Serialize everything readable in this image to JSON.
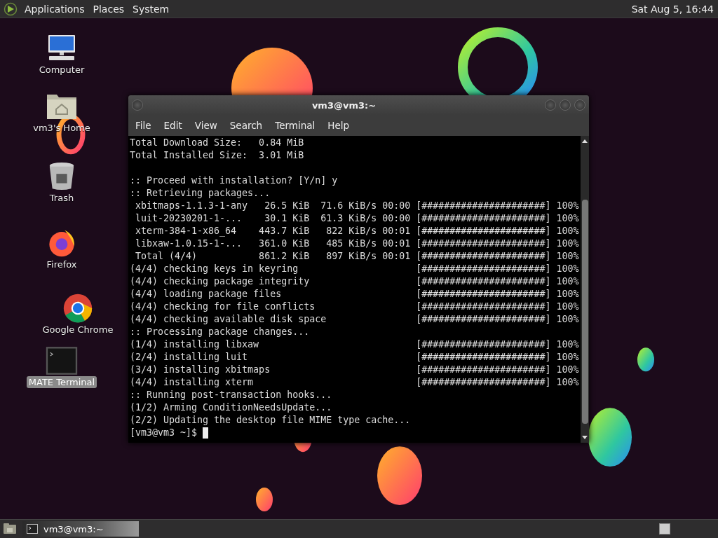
{
  "top_panel": {
    "menus": [
      "Applications",
      "Places",
      "System"
    ],
    "clock": "Sat Aug 5, 16:44"
  },
  "desktop_icons": [
    {
      "label": "Computer",
      "kind": "computer",
      "selected": false
    },
    {
      "label": "vm3's Home",
      "kind": "home",
      "selected": false
    },
    {
      "label": "Trash",
      "kind": "trash",
      "selected": false
    },
    {
      "label": "Firefox",
      "kind": "firefox",
      "selected": false
    },
    {
      "label": "Google Chrome",
      "kind": "chrome",
      "selected": false
    },
    {
      "label": "MATE Terminal",
      "kind": "terminal",
      "selected": true
    }
  ],
  "terminal": {
    "title": "vm3@vm3:~",
    "menu": [
      "File",
      "Edit",
      "View",
      "Search",
      "Terminal",
      "Help"
    ],
    "lines": [
      {
        "kind": "text",
        "text": "Total Download Size:   0.84 MiB"
      },
      {
        "kind": "text",
        "text": "Total Installed Size:  3.01 MiB"
      },
      {
        "kind": "blank"
      },
      {
        "kind": "text",
        "text": ":: Proceed with installation? [Y/n] y"
      },
      {
        "kind": "text",
        "text": ":: Retrieving packages..."
      },
      {
        "kind": "progress",
        "text": " xbitmaps-1.1.3-1-any   26.5 KiB  71.6 KiB/s 00:00",
        "bar": "[######################]",
        "percent": "100%"
      },
      {
        "kind": "progress",
        "text": " luit-20230201-1-...    30.1 KiB  61.3 KiB/s 00:00",
        "bar": "[######################]",
        "percent": "100%"
      },
      {
        "kind": "progress",
        "text": " xterm-384-1-x86_64    443.7 KiB   822 KiB/s 00:01",
        "bar": "[######################]",
        "percent": "100%"
      },
      {
        "kind": "progress",
        "text": " libxaw-1.0.15-1-...   361.0 KiB   485 KiB/s 00:01",
        "bar": "[######################]",
        "percent": "100%"
      },
      {
        "kind": "progress",
        "text": " Total (4/4)           861.2 KiB   897 KiB/s 00:01",
        "bar": "[######################]",
        "percent": "100%"
      },
      {
        "kind": "progress",
        "text": "(4/4) checking keys in keyring",
        "bar": "[######################]",
        "percent": "100%"
      },
      {
        "kind": "progress",
        "text": "(4/4) checking package integrity",
        "bar": "[######################]",
        "percent": "100%"
      },
      {
        "kind": "progress",
        "text": "(4/4) loading package files",
        "bar": "[######################]",
        "percent": "100%"
      },
      {
        "kind": "progress",
        "text": "(4/4) checking for file conflicts",
        "bar": "[######################]",
        "percent": "100%"
      },
      {
        "kind": "progress",
        "text": "(4/4) checking available disk space",
        "bar": "[######################]",
        "percent": "100%"
      },
      {
        "kind": "text",
        "text": ":: Processing package changes..."
      },
      {
        "kind": "progress",
        "text": "(1/4) installing libxaw",
        "bar": "[######################]",
        "percent": "100%"
      },
      {
        "kind": "progress",
        "text": "(2/4) installing luit",
        "bar": "[######################]",
        "percent": "100%"
      },
      {
        "kind": "progress",
        "text": "(3/4) installing xbitmaps",
        "bar": "[######################]",
        "percent": "100%"
      },
      {
        "kind": "progress",
        "text": "(4/4) installing xterm",
        "bar": "[######################]",
        "percent": "100%"
      },
      {
        "kind": "text",
        "text": ":: Running post-transaction hooks..."
      },
      {
        "kind": "text",
        "text": "(1/2) Arming ConditionNeedsUpdate..."
      },
      {
        "kind": "text",
        "text": "(2/2) Updating the desktop file MIME type cache..."
      }
    ],
    "prompt": "[vm3@vm3 ~]$"
  },
  "taskbar": {
    "tasks": [
      {
        "label": "vm3@vm3:~",
        "selected": true
      }
    ]
  }
}
